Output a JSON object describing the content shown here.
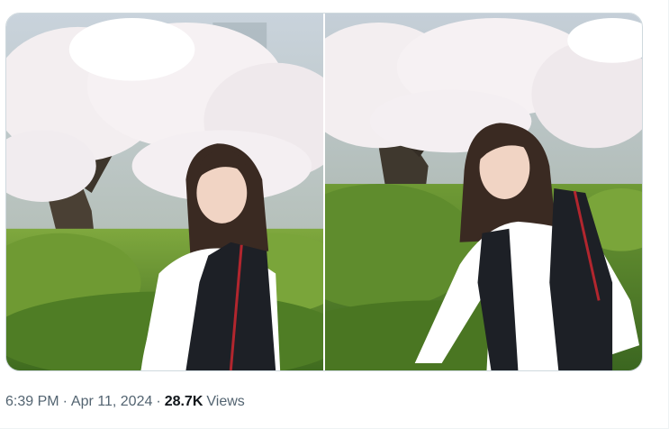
{
  "media": {
    "photos": [
      {
        "icon": "photo-woman-cherry-blossoms-left"
      },
      {
        "icon": "photo-woman-cherry-blossoms-right"
      }
    ]
  },
  "meta": {
    "time": "6:39 PM",
    "separator": "·",
    "date": "Apr 11, 2024",
    "views_count": "28.7K",
    "views_label": "Views"
  },
  "colors": {
    "meta_text": "#536471",
    "emphasis_text": "#0f1419",
    "border": "#cfd9de"
  }
}
